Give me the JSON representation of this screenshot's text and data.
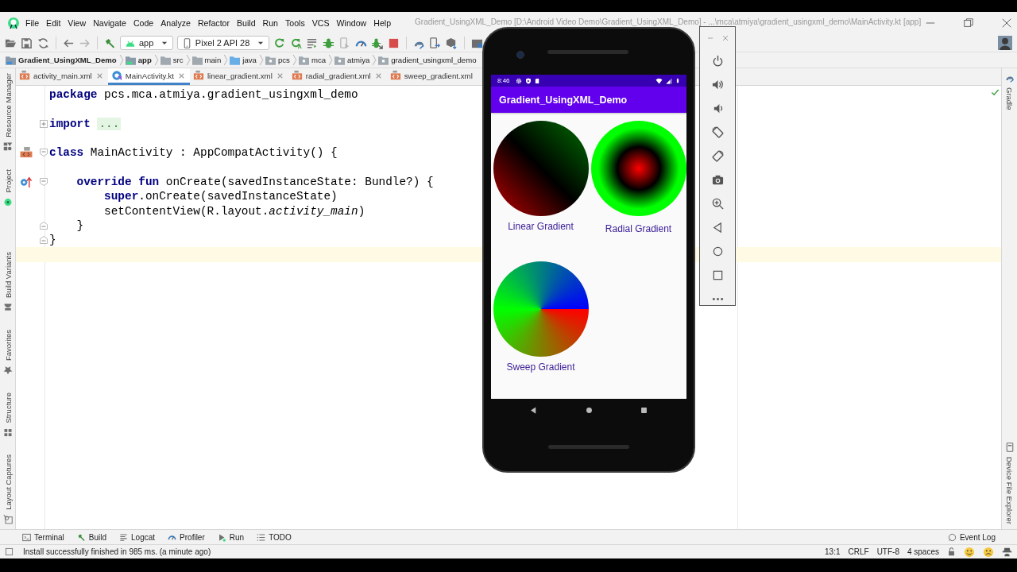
{
  "window": {
    "title": "Gradient_UsingXML_Demo [D:\\Android Video Demo\\Gradient_UsingXML_Demo] - ...\\mca\\atmiya\\gradient_usingxml_demo\\MainActivity.kt [app]"
  },
  "menu": [
    "File",
    "Edit",
    "View",
    "Navigate",
    "Code",
    "Analyze",
    "Refactor",
    "Build",
    "Run",
    "Tools",
    "VCS",
    "Window",
    "Help"
  ],
  "toolbar": {
    "run_config": "app",
    "device": "Pixel 2 API 28"
  },
  "breadcrumbs": [
    {
      "label": "Gradient_UsingXML_Demo",
      "kind": "project"
    },
    {
      "label": "app",
      "kind": "module"
    },
    {
      "label": "src",
      "kind": "folder"
    },
    {
      "label": "main",
      "kind": "folder"
    },
    {
      "label": "java",
      "kind": "source"
    },
    {
      "label": "pcs",
      "kind": "package"
    },
    {
      "label": "mca",
      "kind": "package"
    },
    {
      "label": "atmiya",
      "kind": "package"
    },
    {
      "label": "gradient_usingxml_demo",
      "kind": "package"
    }
  ],
  "tabs": [
    {
      "label": "activity_main.xml",
      "kind": "xml",
      "selected": false
    },
    {
      "label": "MainActivity.kt",
      "kind": "kotlin",
      "selected": true
    },
    {
      "label": "linear_gradient.xml",
      "kind": "xml",
      "selected": false
    },
    {
      "label": "radial_gradient.xml",
      "kind": "xml",
      "selected": false
    },
    {
      "label": "sweep_gradient.xml",
      "kind": "xml",
      "selected": false
    }
  ],
  "left_strip": {
    "top": [
      {
        "label": "Resource Manager",
        "kind": "resources"
      },
      {
        "label": "Project",
        "kind": "project"
      }
    ],
    "bottom": [
      {
        "label": "Build Variants",
        "kind": "variants"
      },
      {
        "label": "Favorites",
        "kind": "favorites"
      },
      {
        "label": "Structure",
        "kind": "structure"
      },
      {
        "label": "Layout Captures",
        "kind": "captures"
      }
    ]
  },
  "right_strip": {
    "top": [
      {
        "label": "Gradle",
        "kind": "gradle"
      }
    ],
    "bottom": [
      {
        "label": "Device File Explorer",
        "kind": "files"
      }
    ]
  },
  "editor": {
    "lines": [
      {
        "kind": "package",
        "text": "**package** pcs.mca.atmiya.gradient_usingxml_demo",
        "current": false
      },
      {
        "kind": "blank",
        "current": false
      },
      {
        "kind": "import",
        "text": "**import**",
        "folded": "...",
        "current": false
      },
      {
        "kind": "blank",
        "current": false
      },
      {
        "kind": "class",
        "text": "**class** MainActivity : AppCompatActivity() {",
        "current": false
      },
      {
        "kind": "blank",
        "current": false
      },
      {
        "kind": "method",
        "text": "    **override fun** onCreate(savedInstanceState: Bundle?) {",
        "current": false
      },
      {
        "kind": "statement",
        "text": "        **super**.onCreate(savedInstanceState)",
        "current": false
      },
      {
        "kind": "statement",
        "text": "        setContentView(R.layout.*activity_main*)",
        "current": false
      },
      {
        "kind": "close",
        "text": "    }",
        "current": false
      },
      {
        "kind": "close",
        "text": "}",
        "current": false
      },
      {
        "kind": "blank",
        "current": true
      }
    ]
  },
  "bottom_bar": {
    "tools": [
      {
        "label": "Terminal",
        "kind": "terminal"
      },
      {
        "label": "Build",
        "kind": "build"
      },
      {
        "label": "Logcat",
        "kind": "logcat"
      },
      {
        "label": "Profiler",
        "kind": "profiler"
      },
      {
        "label": "Run",
        "kind": "run"
      },
      {
        "label": "TODO",
        "kind": "todo"
      }
    ],
    "event_log": "Event Log"
  },
  "status_bar": {
    "message": "Install successfully finished in 985 ms. (a minute ago)",
    "items": [
      "13:1",
      "CRLF",
      "UTF-8",
      "4 spaces"
    ]
  },
  "emulator": {
    "time": "8:46",
    "app_title": "Gradient_UsingXML_Demo",
    "gradients": [
      {
        "label": "Linear Gradient",
        "kind": "linear"
      },
      {
        "label": "Radial Gradient",
        "kind": "radial"
      },
      {
        "label": "Sweep Gradient",
        "kind": "sweep"
      }
    ]
  }
}
